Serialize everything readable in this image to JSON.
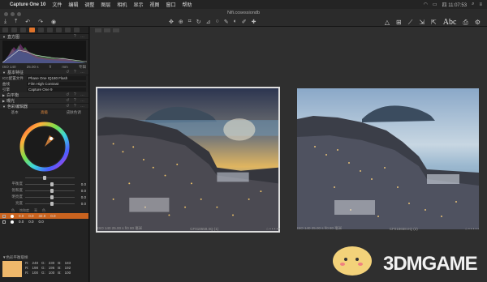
{
  "menubar": {
    "apple": "",
    "items": [
      "Capture One 10",
      "文件",
      "编辑",
      "调整",
      "图层",
      "相机",
      "显示",
      "视图",
      "窗口",
      "帮助"
    ],
    "clock": "四 11:07:53"
  },
  "toolbar": {
    "doc_title": "Nifi.cosessiondb",
    "text_button": "Abc"
  },
  "left_panel": {
    "histogram_title": "直方图",
    "histogram_readout": {
      "iso": "ISO 140",
      "shutter": "25.00 s",
      "aperture": "f/",
      "focal": "mm",
      "ev": "专辑"
    },
    "base_title": "基本特征",
    "icc_label": "ICC配置文件",
    "icc_value": "Phase One IQ180 Flash",
    "curve_label": "曲线",
    "curve_value": "Film High Contrast",
    "engine_label": "引擎",
    "engine_value": "Capture One 9",
    "sections": [
      "白平衡",
      "曝光",
      "色彩编辑器"
    ],
    "tabs": [
      "基本",
      "高级",
      "皮肤色调"
    ],
    "sliders": [
      {
        "label": "平衡度",
        "value": "0.0",
        "pos": 0.5
      },
      {
        "label": "饱和度",
        "value": "0.0",
        "pos": 0.5
      },
      {
        "label": "明亮度",
        "value": "0.0",
        "pos": 0.5
      },
      {
        "label": "亮度",
        "value": "0.0",
        "pos": 0.5
      }
    ],
    "zone_headers": [
      "色",
      "饱和度",
      "亮",
      "色"
    ],
    "zones": [
      {
        "a": "0.0",
        "b": "0.0",
        "c": "32.0",
        "d": "0.0",
        "selected": true
      },
      {
        "a": "0.0",
        "b": "0.0",
        "c": "0.0",
        "d": "",
        "selected": false
      }
    ],
    "picker_title": "色彩平衡取样",
    "picker_values": [
      {
        "r": "248",
        "g": "230",
        "b": "183"
      },
      {
        "r": "198",
        "g": "196",
        "b": "192"
      },
      {
        "r": "100",
        "g": "100",
        "b": "100"
      }
    ]
  },
  "viewer": {
    "captions": [
      {
        "meta": "ISO 140  25.00 s  f/0  80 毫米",
        "name": "CF018659.IIQ (1)"
      },
      {
        "meta": "ISO 140  25.00 s  f/0  80 毫米",
        "name": "CF018658.IIQ (2)"
      }
    ]
  },
  "watermark": {
    "text": "3DMGAME"
  },
  "colors": {
    "accent": "#e0732a",
    "selected_row": "#c9631f",
    "picker_swatch": "#efb86b"
  }
}
